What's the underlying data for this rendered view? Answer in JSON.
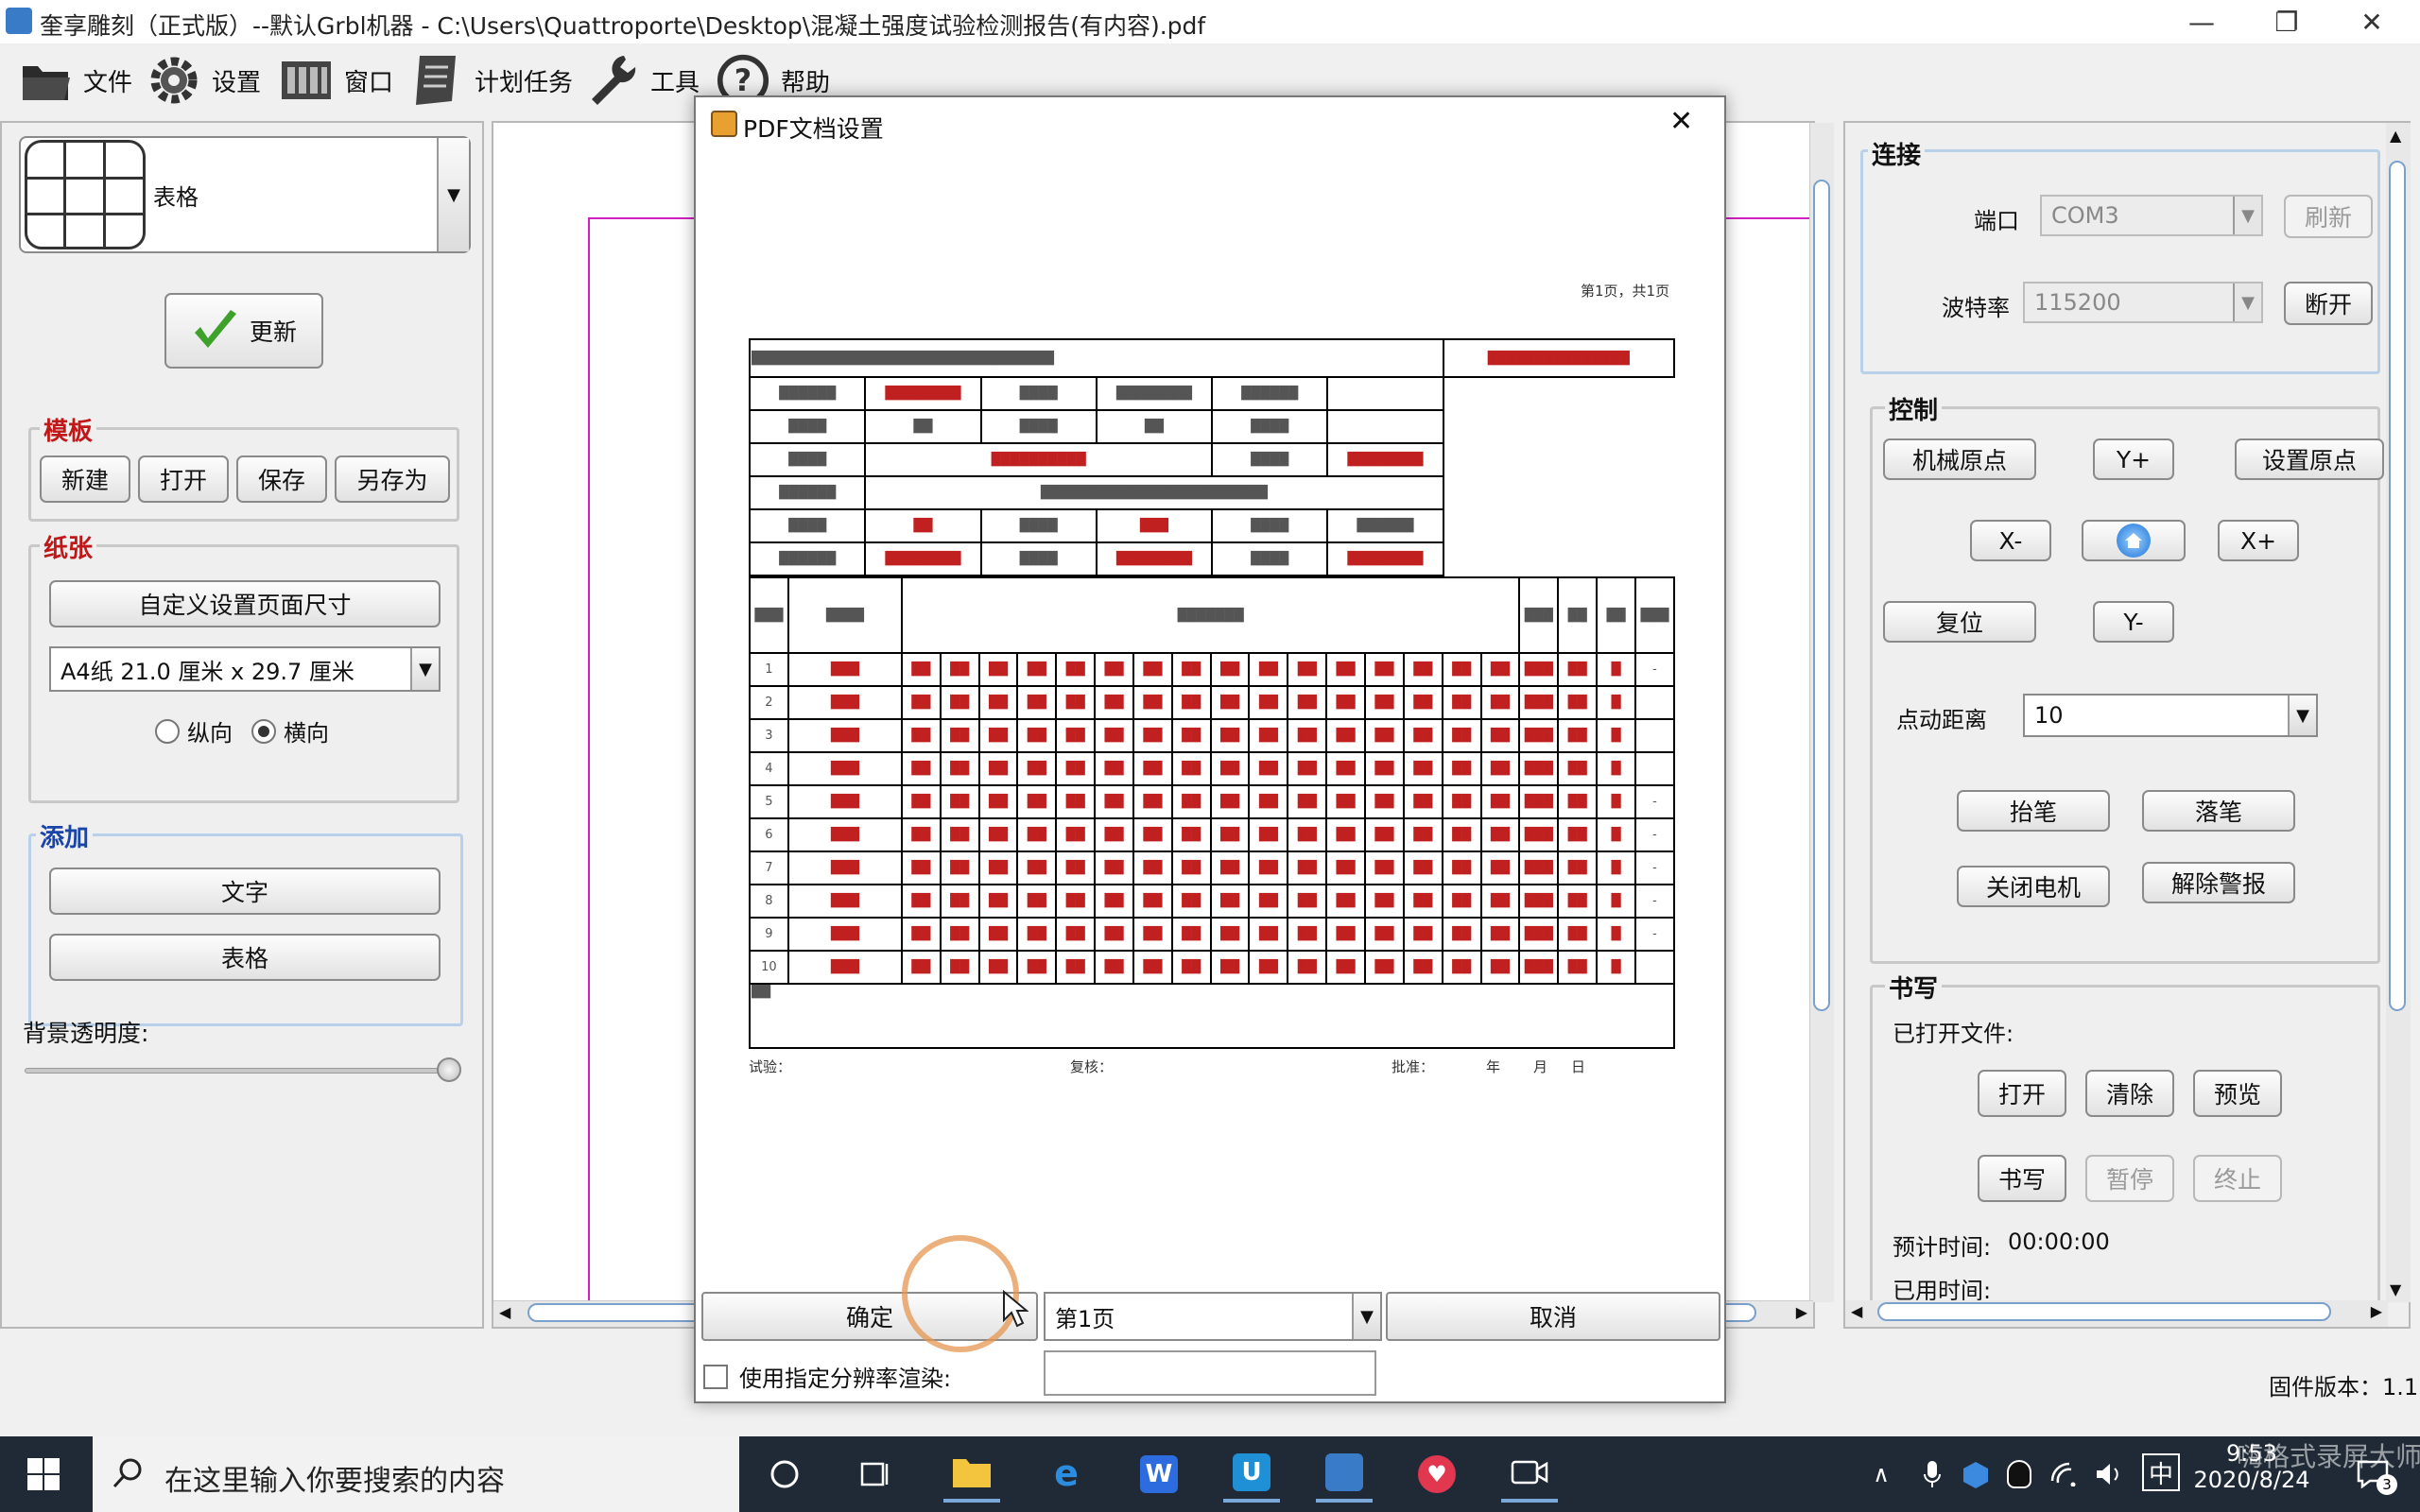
{
  "window": {
    "title": "奎享雕刻（正式版）--默认Grbl机器 - C:\\Users\\Quattroporte\\Desktop\\混凝土强度试验检测报告(有内容).pdf",
    "minimize": "—",
    "maximize": "❐",
    "close": "✕"
  },
  "menu": [
    {
      "label": "文件",
      "icon": "folder-icon"
    },
    {
      "label": "设置",
      "icon": "gear-icon"
    },
    {
      "label": "窗口",
      "icon": "window-icon"
    },
    {
      "label": "计划任务",
      "icon": "scroll-icon"
    },
    {
      "label": "工具",
      "icon": "wrench-icon"
    },
    {
      "label": "帮助",
      "icon": "help-icon"
    }
  ],
  "left": {
    "template_select": "表格",
    "update_btn": "更新",
    "template_group": "模板",
    "template_btns": [
      "新建",
      "打开",
      "保存",
      "另存为"
    ],
    "paper_group": "纸张",
    "custom_size_btn": "自定义设置页面尺寸",
    "paper_select": "A4纸 21.0 厘米 x 29.7 厘米",
    "orientation_portrait": "纵向",
    "orientation_landscape": "横向",
    "orientation_selected": "landscape",
    "add_group": "添加",
    "add_text_btn": "文字",
    "add_table_btn": "表格",
    "opacity_label": "背景透明度:",
    "opacity_value": 1.0
  },
  "dialog": {
    "title": "PDF文档设置",
    "close": "✕",
    "ok_btn": "确定",
    "page_select": "第1页",
    "cancel_btn": "取消",
    "resolution_checkbox": "使用指定分辨率渲染:",
    "resolution_checked": false,
    "resolution_value": "",
    "doc_page_label": "第1页，共1页",
    "doc_footer": [
      "试验：",
      "复核：",
      "批准：",
      "年",
      "月",
      "日"
    ]
  },
  "right": {
    "connect_group": "连接",
    "port_label": "端口",
    "port_value": "COM3",
    "refresh_btn": "刷新",
    "baud_label": "波特率",
    "baud_value": "115200",
    "disconnect_btn": "断开",
    "control_group": "控制",
    "machine_origin_btn": "机械原点",
    "yplus_btn": "Y+",
    "set_origin_btn": "设置原点",
    "xminus_btn": "X-",
    "xplus_btn": "X+",
    "reset_btn": "复位",
    "yminus_btn": "Y-",
    "jog_label": "点动距离",
    "jog_value": "10",
    "pen_up_btn": "抬笔",
    "pen_down_btn": "落笔",
    "motor_off_btn": "关闭电机",
    "clear_alarm_btn": "解除警报",
    "write_group": "书写",
    "opened_file_label": "已打开文件:",
    "open_btn": "打开",
    "clear_btn": "清除",
    "preview_btn": "预览",
    "write_btn": "书写",
    "pause_btn": "暂停",
    "stop_btn": "终止",
    "est_time_label": "预计时间:",
    "est_time_value": "00:00:00",
    "used_time_label": "已用时间:"
  },
  "status": {
    "firmware_label": "固件版本：1.1"
  },
  "taskbar": {
    "search_placeholder": "在这里输入你要搜索的内容",
    "ime": "中",
    "time": "9:53",
    "date": "2020/8/24",
    "notifications": "3",
    "watermark": "嗨格式录屏大师"
  }
}
